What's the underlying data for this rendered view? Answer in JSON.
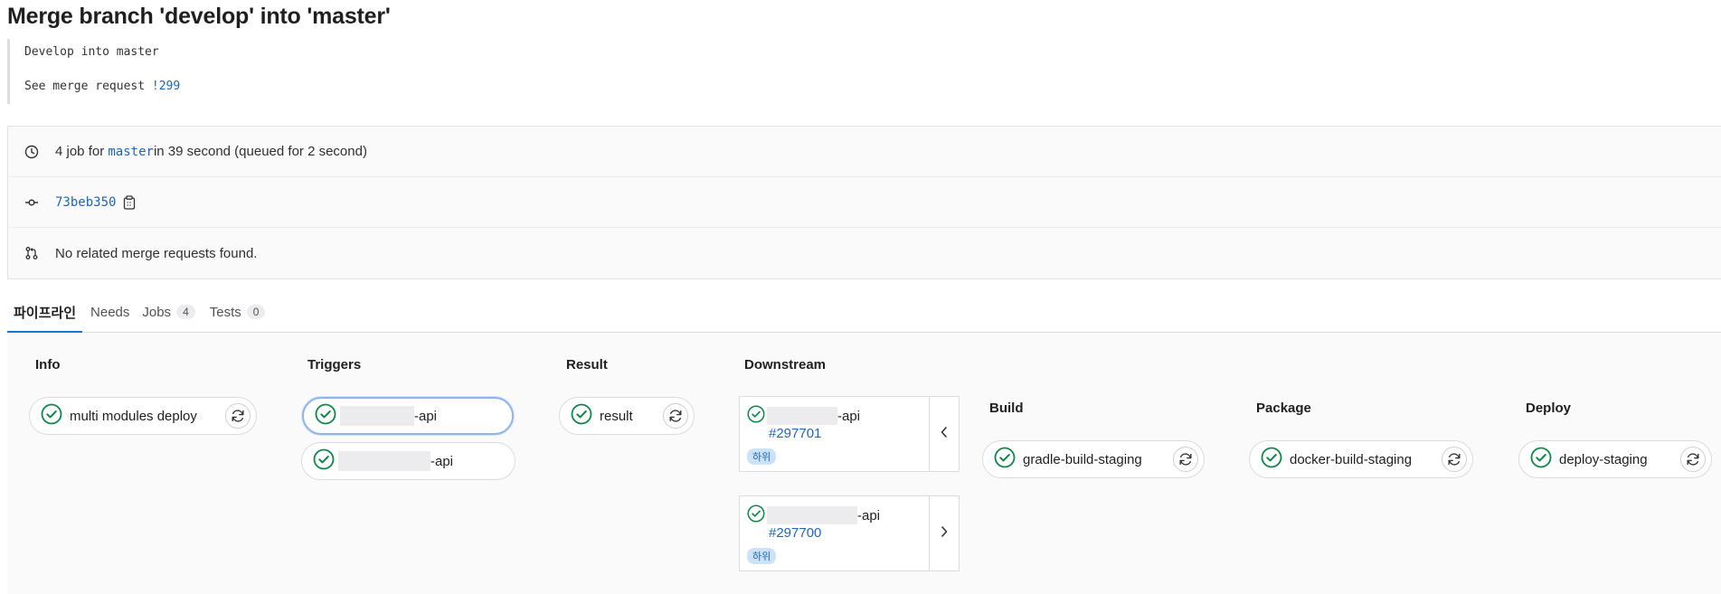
{
  "page": {
    "title": "Merge branch 'develop' into 'master'",
    "commit_message": {
      "line1": "Develop into master",
      "line2_prefix": "See merge request ",
      "mr_link": "!299"
    }
  },
  "pipeline_info": {
    "jobs_text": "4 job for ",
    "branch": "master",
    "duration_text": " in 39 second (queued for 2 second)",
    "sha": "73beb350",
    "related_mr_text": "No related merge requests found."
  },
  "tabs": [
    {
      "label": "파이프라인",
      "active": true
    },
    {
      "label": "Needs"
    },
    {
      "label": "Jobs",
      "count": "4"
    },
    {
      "label": "Tests",
      "count": "0"
    }
  ],
  "stages": {
    "info": {
      "title": "Info",
      "jobs": [
        {
          "name": "multi modules deploy"
        }
      ]
    },
    "triggers": {
      "title": "Triggers",
      "jobs": [
        {
          "name": "-api"
        },
        {
          "name": "-api"
        }
      ]
    },
    "result": {
      "title": "Result",
      "jobs": [
        {
          "name": "result"
        }
      ]
    },
    "downstream": {
      "title": "Downstream",
      "pipelines": [
        {
          "name": "-api",
          "id": "#297701",
          "tag": "하위"
        },
        {
          "name": "-api",
          "id": "#297700",
          "tag": "하위"
        }
      ]
    },
    "build": {
      "title": "Build",
      "jobs": [
        {
          "name": "gradle-build-staging"
        }
      ]
    },
    "package": {
      "title": "Package",
      "jobs": [
        {
          "name": "docker-build-staging"
        }
      ]
    },
    "deploy": {
      "title": "Deploy",
      "jobs": [
        {
          "name": "deploy-staging"
        }
      ]
    }
  },
  "colors": {
    "success": "#108548",
    "link": "#1f65b8",
    "accent": "#1f75cb"
  }
}
